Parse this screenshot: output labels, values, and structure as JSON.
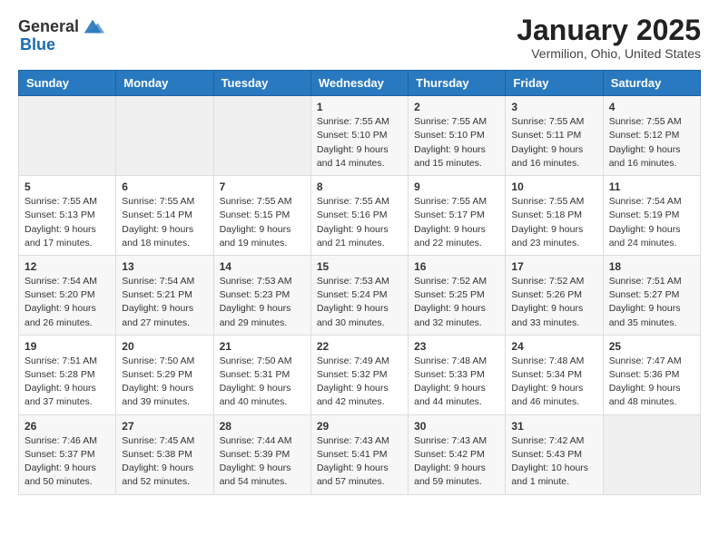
{
  "header": {
    "logo_general": "General",
    "logo_blue": "Blue",
    "month_title": "January 2025",
    "location": "Vermilion, Ohio, United States"
  },
  "weekdays": [
    "Sunday",
    "Monday",
    "Tuesday",
    "Wednesday",
    "Thursday",
    "Friday",
    "Saturday"
  ],
  "weeks": [
    [
      {
        "day": "",
        "info": ""
      },
      {
        "day": "",
        "info": ""
      },
      {
        "day": "",
        "info": ""
      },
      {
        "day": "1",
        "info": "Sunrise: 7:55 AM\nSunset: 5:10 PM\nDaylight: 9 hours\nand 14 minutes."
      },
      {
        "day": "2",
        "info": "Sunrise: 7:55 AM\nSunset: 5:10 PM\nDaylight: 9 hours\nand 15 minutes."
      },
      {
        "day": "3",
        "info": "Sunrise: 7:55 AM\nSunset: 5:11 PM\nDaylight: 9 hours\nand 16 minutes."
      },
      {
        "day": "4",
        "info": "Sunrise: 7:55 AM\nSunset: 5:12 PM\nDaylight: 9 hours\nand 16 minutes."
      }
    ],
    [
      {
        "day": "5",
        "info": "Sunrise: 7:55 AM\nSunset: 5:13 PM\nDaylight: 9 hours\nand 17 minutes."
      },
      {
        "day": "6",
        "info": "Sunrise: 7:55 AM\nSunset: 5:14 PM\nDaylight: 9 hours\nand 18 minutes."
      },
      {
        "day": "7",
        "info": "Sunrise: 7:55 AM\nSunset: 5:15 PM\nDaylight: 9 hours\nand 19 minutes."
      },
      {
        "day": "8",
        "info": "Sunrise: 7:55 AM\nSunset: 5:16 PM\nDaylight: 9 hours\nand 21 minutes."
      },
      {
        "day": "9",
        "info": "Sunrise: 7:55 AM\nSunset: 5:17 PM\nDaylight: 9 hours\nand 22 minutes."
      },
      {
        "day": "10",
        "info": "Sunrise: 7:55 AM\nSunset: 5:18 PM\nDaylight: 9 hours\nand 23 minutes."
      },
      {
        "day": "11",
        "info": "Sunrise: 7:54 AM\nSunset: 5:19 PM\nDaylight: 9 hours\nand 24 minutes."
      }
    ],
    [
      {
        "day": "12",
        "info": "Sunrise: 7:54 AM\nSunset: 5:20 PM\nDaylight: 9 hours\nand 26 minutes."
      },
      {
        "day": "13",
        "info": "Sunrise: 7:54 AM\nSunset: 5:21 PM\nDaylight: 9 hours\nand 27 minutes."
      },
      {
        "day": "14",
        "info": "Sunrise: 7:53 AM\nSunset: 5:23 PM\nDaylight: 9 hours\nand 29 minutes."
      },
      {
        "day": "15",
        "info": "Sunrise: 7:53 AM\nSunset: 5:24 PM\nDaylight: 9 hours\nand 30 minutes."
      },
      {
        "day": "16",
        "info": "Sunrise: 7:52 AM\nSunset: 5:25 PM\nDaylight: 9 hours\nand 32 minutes."
      },
      {
        "day": "17",
        "info": "Sunrise: 7:52 AM\nSunset: 5:26 PM\nDaylight: 9 hours\nand 33 minutes."
      },
      {
        "day": "18",
        "info": "Sunrise: 7:51 AM\nSunset: 5:27 PM\nDaylight: 9 hours\nand 35 minutes."
      }
    ],
    [
      {
        "day": "19",
        "info": "Sunrise: 7:51 AM\nSunset: 5:28 PM\nDaylight: 9 hours\nand 37 minutes."
      },
      {
        "day": "20",
        "info": "Sunrise: 7:50 AM\nSunset: 5:29 PM\nDaylight: 9 hours\nand 39 minutes."
      },
      {
        "day": "21",
        "info": "Sunrise: 7:50 AM\nSunset: 5:31 PM\nDaylight: 9 hours\nand 40 minutes."
      },
      {
        "day": "22",
        "info": "Sunrise: 7:49 AM\nSunset: 5:32 PM\nDaylight: 9 hours\nand 42 minutes."
      },
      {
        "day": "23",
        "info": "Sunrise: 7:48 AM\nSunset: 5:33 PM\nDaylight: 9 hours\nand 44 minutes."
      },
      {
        "day": "24",
        "info": "Sunrise: 7:48 AM\nSunset: 5:34 PM\nDaylight: 9 hours\nand 46 minutes."
      },
      {
        "day": "25",
        "info": "Sunrise: 7:47 AM\nSunset: 5:36 PM\nDaylight: 9 hours\nand 48 minutes."
      }
    ],
    [
      {
        "day": "26",
        "info": "Sunrise: 7:46 AM\nSunset: 5:37 PM\nDaylight: 9 hours\nand 50 minutes."
      },
      {
        "day": "27",
        "info": "Sunrise: 7:45 AM\nSunset: 5:38 PM\nDaylight: 9 hours\nand 52 minutes."
      },
      {
        "day": "28",
        "info": "Sunrise: 7:44 AM\nSunset: 5:39 PM\nDaylight: 9 hours\nand 54 minutes."
      },
      {
        "day": "29",
        "info": "Sunrise: 7:43 AM\nSunset: 5:41 PM\nDaylight: 9 hours\nand 57 minutes."
      },
      {
        "day": "30",
        "info": "Sunrise: 7:43 AM\nSunset: 5:42 PM\nDaylight: 9 hours\nand 59 minutes."
      },
      {
        "day": "31",
        "info": "Sunrise: 7:42 AM\nSunset: 5:43 PM\nDaylight: 10 hours\nand 1 minute."
      },
      {
        "day": "",
        "info": ""
      }
    ]
  ]
}
